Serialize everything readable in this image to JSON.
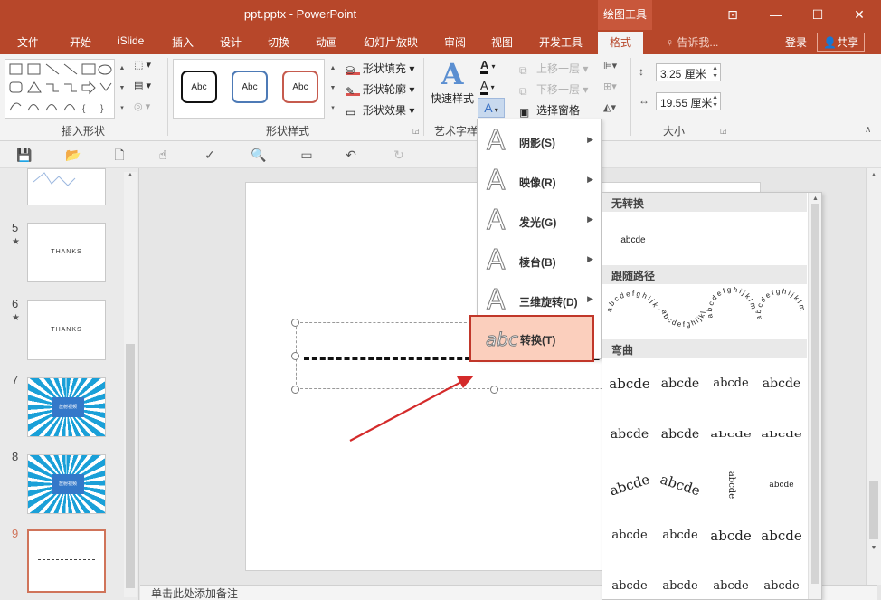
{
  "window": {
    "title": "ppt.pptx - PowerPoint",
    "context_tab_group": "绘图工具",
    "controls": [
      "⊡",
      "—",
      "☐",
      "✕"
    ]
  },
  "tabs": [
    "文件",
    "开始",
    "iSlide",
    "插入",
    "设计",
    "切换",
    "动画",
    "幻灯片放映",
    "审阅",
    "视图",
    "开发工具",
    "格式"
  ],
  "tell_me": "告诉我...",
  "login": "登录",
  "share": "共享",
  "ribbon": {
    "insert_shapes_label": "插入形状",
    "shape_styles_label": "形状样式",
    "style_sample": "Abc",
    "shape_fill": "形状填充",
    "shape_outline": "形状轮廓",
    "shape_effects": "形状效果",
    "quick_styles": "快速样式",
    "art_text_label": "艺术字样",
    "bring_forward": "上移一层",
    "send_backward": "下移一层",
    "selection_pane": "选择窗格",
    "size_label": "大小",
    "height": "3.25 厘米",
    "width": "19.55 厘米"
  },
  "thumbnails": [
    {
      "num": "5",
      "star": "★",
      "text": "THANKS"
    },
    {
      "num": "6",
      "star": "★",
      "text": "THANKS"
    },
    {
      "num": "7",
      "text": "放射视频"
    },
    {
      "num": "8",
      "text": "放射视频"
    },
    {
      "num": "9",
      "text": ""
    }
  ],
  "notes_placeholder": "单击此处添加备注",
  "text_effects_menu": [
    {
      "glyph": "A",
      "label": "阴影(S)"
    },
    {
      "glyph": "A",
      "label": "映像(R)"
    },
    {
      "glyph": "A",
      "label": "发光(G)"
    },
    {
      "glyph": "A",
      "label": "棱台(B)"
    },
    {
      "glyph": "A",
      "label": "三维旋转(D)"
    },
    {
      "glyph": "abc",
      "label": "转换(T)"
    }
  ],
  "gallery": {
    "sections": [
      "无转换",
      "跟随路径",
      "弯曲"
    ],
    "no_transform_sample": "abcde",
    "warp_sample": "abcde",
    "follow_path_sample": "abcdefghijklm"
  },
  "colors": {
    "accent": "#b7472a",
    "highlight": "#fbcfbd",
    "highlight_border": "#c1372a",
    "arrow": "#d42a2a"
  }
}
